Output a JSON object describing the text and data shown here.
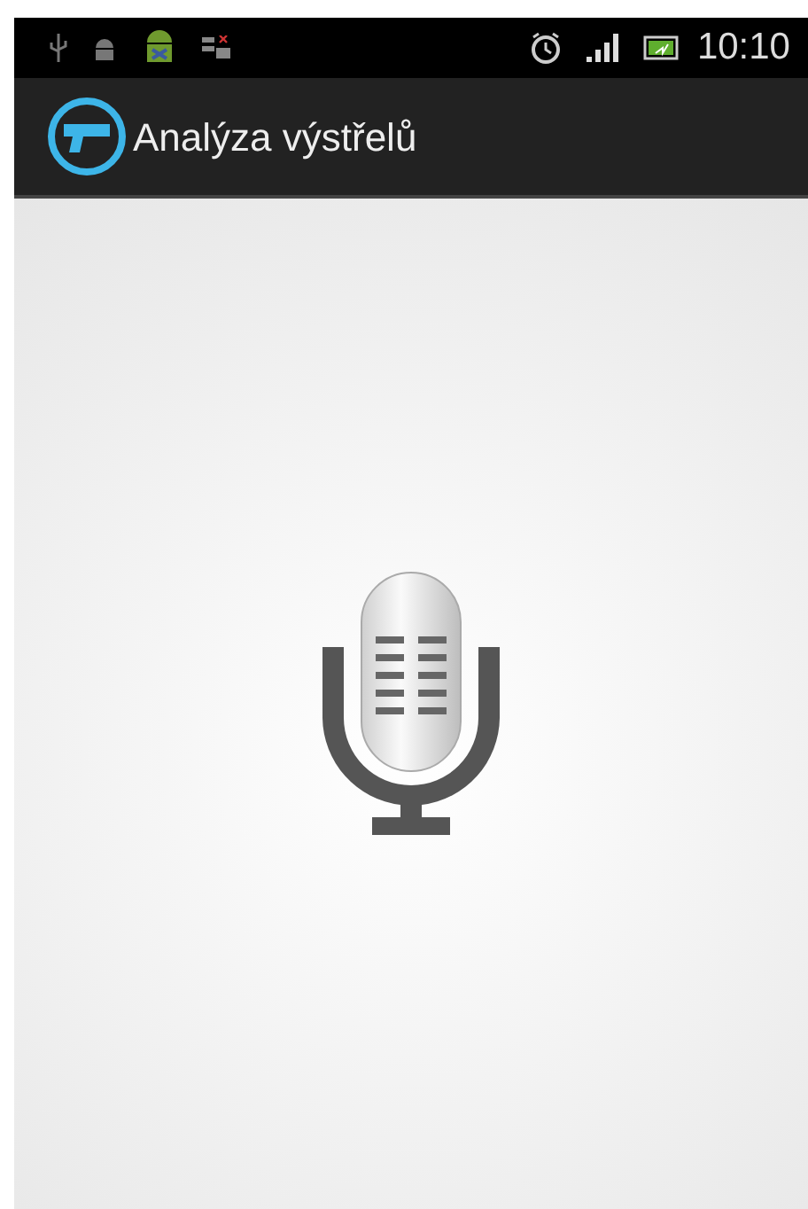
{
  "status_bar": {
    "time": "10:10"
  },
  "action_bar": {
    "title": "Analýza výstřelů"
  }
}
